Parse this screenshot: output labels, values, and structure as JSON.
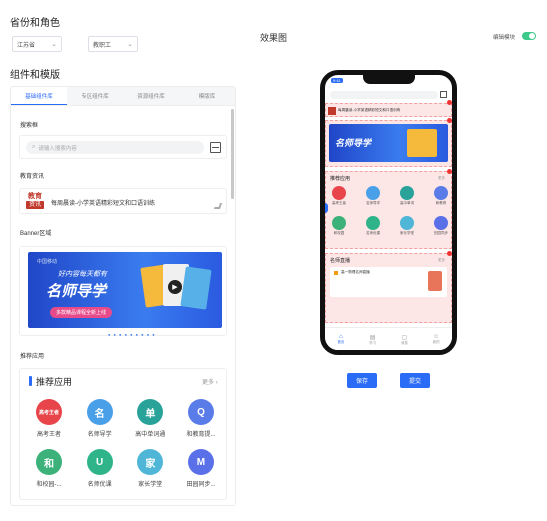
{
  "header": {
    "section_title": "省份和角色",
    "province_value": "江苏省",
    "role_value": "教职工",
    "preview_title": "效果图",
    "toggle_label": "编辑模块"
  },
  "components": {
    "section_title": "组件和模版",
    "tabs": [
      "基础组件库",
      "专区组件库",
      "资源组件库",
      "模版库"
    ],
    "search_label": "搜索框",
    "search_placeholder": "请输入搜索内容",
    "edu_label": "教育资讯",
    "edu_logo_top": "教育",
    "edu_logo_bottom": "资讯",
    "edu_text": "每周晨读-小学英语精彩短文和口语训练",
    "banner_label": "Banner区域",
    "banner_brand": "中国移动",
    "banner_line1": "好内容每天都有",
    "banner_main": "名师导学",
    "banner_sub": "多款精品课程全新上线",
    "rec_label": "推荐应用",
    "rec_title": "推荐应用",
    "rec_more": "更多",
    "apps": [
      {
        "label": "高考王者",
        "icon": "高考王者",
        "color": "#e8454a"
      },
      {
        "label": "名师导学",
        "icon": "名",
        "color": "#4aa0e8"
      },
      {
        "label": "高中单词通",
        "icon": "单",
        "color": "#29a39a"
      },
      {
        "label": "和教育提...",
        "icon": "Q",
        "color": "#5a7ce8"
      },
      {
        "label": "和校园-...",
        "icon": "和",
        "color": "#3cb27a"
      },
      {
        "label": "名师优课",
        "icon": "U",
        "color": "#2fb48a"
      },
      {
        "label": "家长学堂",
        "icon": "家",
        "color": "#4fb6d8"
      },
      {
        "label": "田园同步...",
        "icon": "M",
        "color": "#5a70e8"
      }
    ]
  },
  "phone": {
    "time": "9:41",
    "edu_text": "每周晨读-小学英语精彩短文和口语训练",
    "banner_main": "名师导学",
    "rec_title": "推荐应用",
    "rec_more": "更多",
    "app_labels": [
      "高考王者",
      "名师导学",
      "高中单词",
      "和教育",
      "和校园",
      "名师优课",
      "家长学堂",
      "田园同步"
    ],
    "live_title": "名师直播",
    "live_more": "更多",
    "live_item": "高一物理名师直播",
    "nav": [
      "首页",
      "学习",
      "消息",
      "我的"
    ]
  },
  "actions": {
    "save_label": "保存",
    "submit_label": "提交"
  },
  "colors": {
    "accent": "#2b6cf6",
    "toggle_on": "#3cc98b",
    "banner_blue": "#2046c8",
    "highlight": "#fde6e6"
  }
}
